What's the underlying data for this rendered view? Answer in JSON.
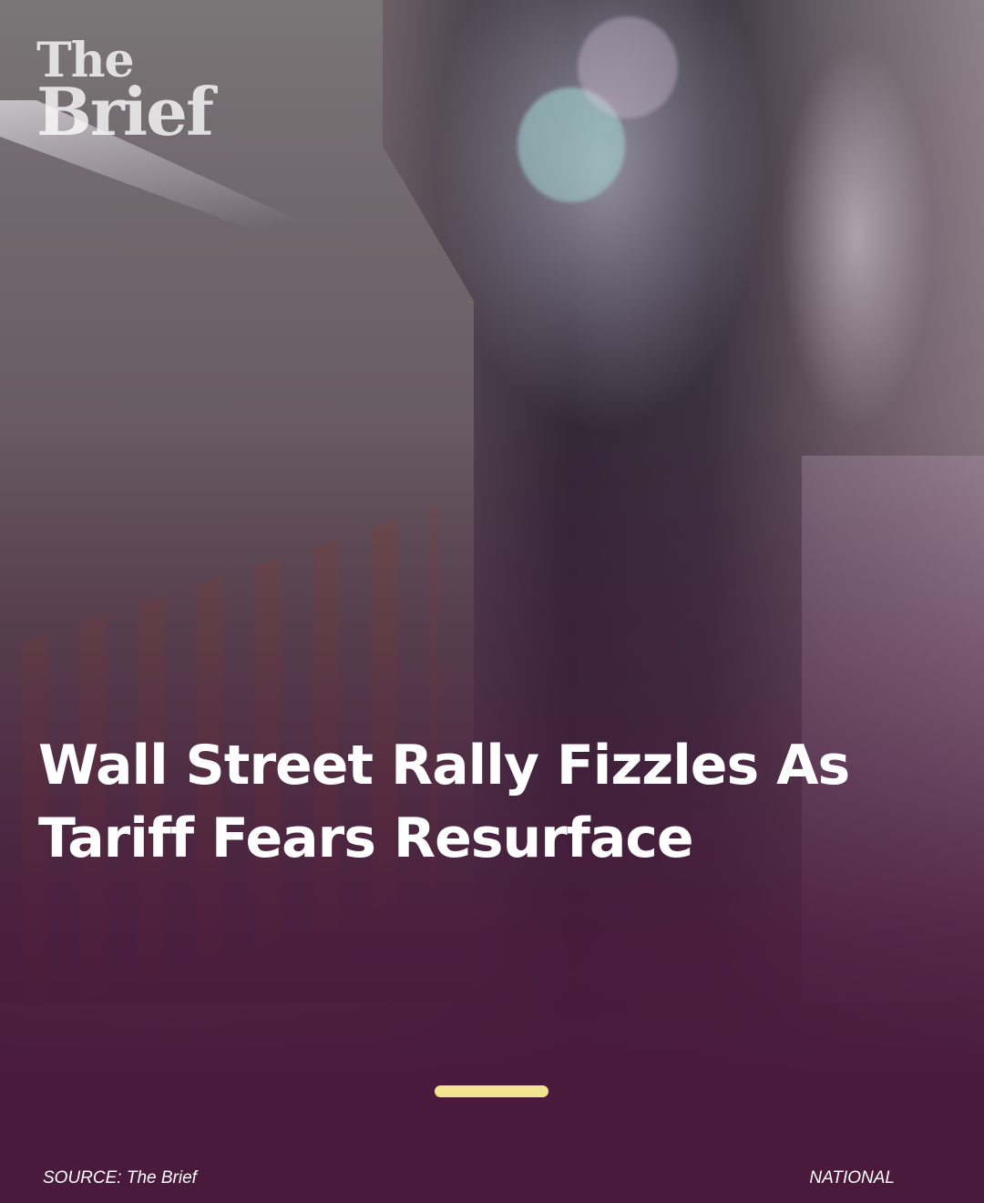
{
  "brand": {
    "logo_line1": "The",
    "logo_line2": "Brief"
  },
  "story": {
    "headline": "Wall Street Rally Fizzles As Tariff Fears Resurface"
  },
  "footer": {
    "source": "SOURCE: The Brief",
    "category": "NATIONAL"
  },
  "colors": {
    "background": "#4a1a3a",
    "indicator": "#f2e48f",
    "text": "#ffffff"
  },
  "icons": {
    "indicator": "slide-indicator-bar"
  }
}
